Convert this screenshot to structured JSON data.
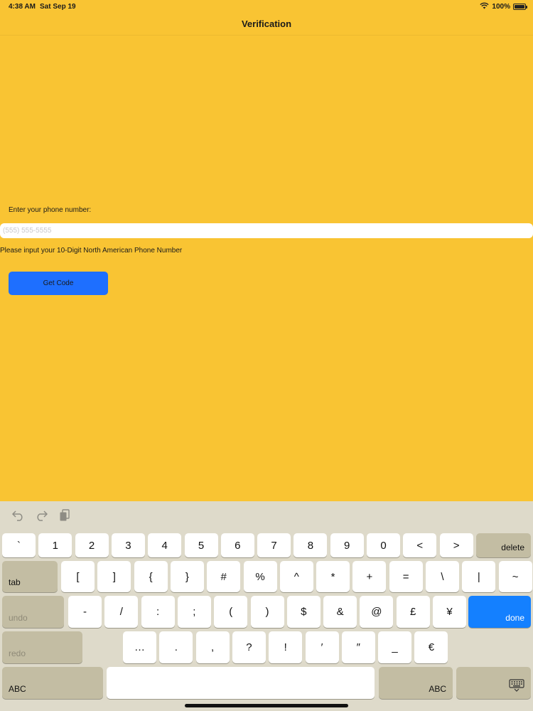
{
  "status_bar": {
    "time": "4:38 AM",
    "date": "Sat Sep 19",
    "battery": "100%",
    "battery_level": 1.0
  },
  "nav": {
    "title": "Verification"
  },
  "form": {
    "label": "Enter your phone number:",
    "input_placeholder": "(555) 555-5555",
    "input_value": "",
    "hint": "Please input your 10-Digit North American Phone Number",
    "button_label": "Get Code"
  },
  "colors": {
    "background": "#F9C433",
    "button": "#1E6FFF",
    "keyboard": "#DEDACA",
    "done_key": "#1480FF"
  },
  "keyboard": {
    "toolbar": [
      "undo-arrow-icon",
      "redo-arrow-icon",
      "paste-clipboard-icon"
    ],
    "row1": [
      "`",
      "1",
      "2",
      "3",
      "4",
      "5",
      "6",
      "7",
      "8",
      "9",
      "0",
      "<",
      ">"
    ],
    "row1_end": "delete",
    "row2_start": "tab",
    "row2": [
      "[",
      "]",
      "{",
      "}",
      "#",
      "%",
      "^",
      "*",
      "+",
      "=",
      "\\",
      "|",
      "~"
    ],
    "row3_start": "undo",
    "row3": [
      "-",
      "/",
      ":",
      ";",
      "(",
      ")",
      "$",
      "&",
      "@",
      "£",
      "¥"
    ],
    "row3_end": "done",
    "row4_start": "redo",
    "row4": [
      "…",
      ".",
      ",",
      "?",
      "!",
      "′",
      "″",
      "_",
      "€"
    ],
    "row5_left": "ABC",
    "row5_right": "ABC",
    "dismiss_icon": "keyboard-dismiss-icon"
  }
}
